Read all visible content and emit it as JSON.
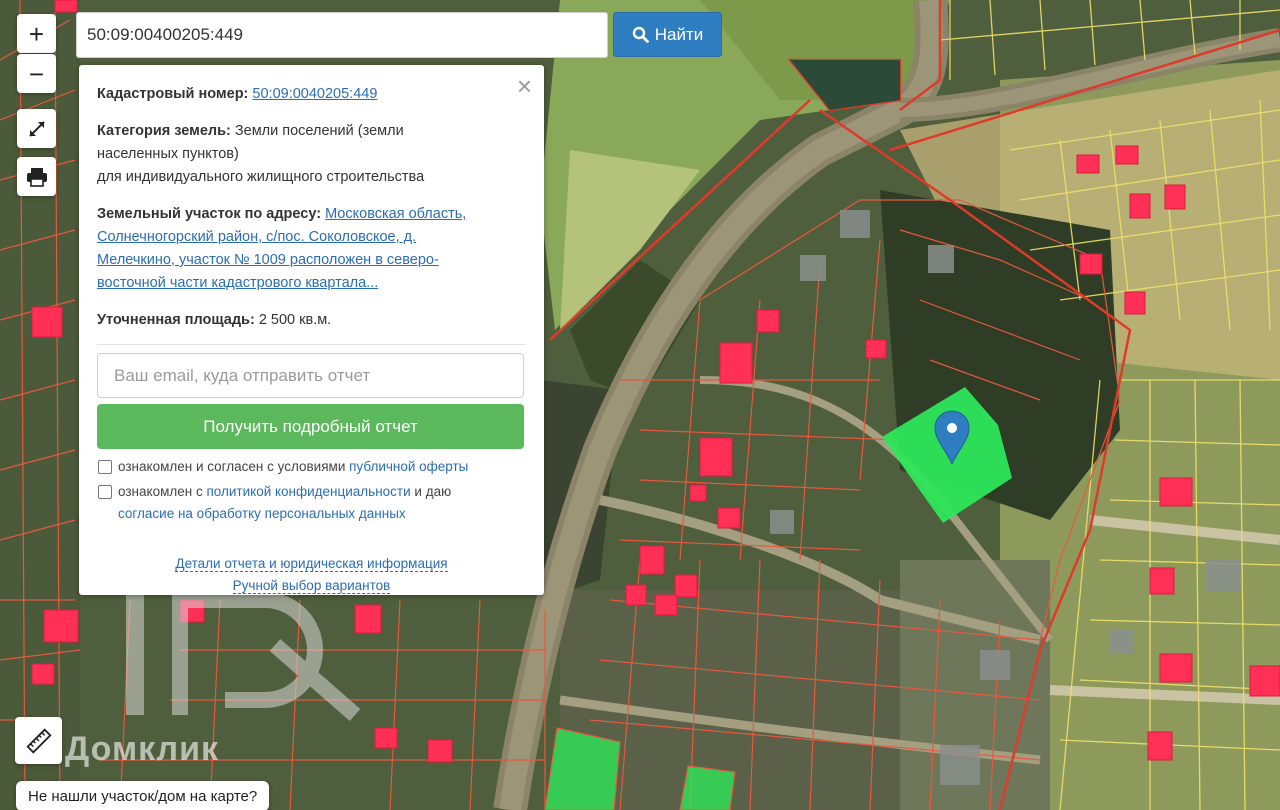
{
  "search": {
    "value": "50:09:00400205:449",
    "button_label": "Найти",
    "button_icon": "search-icon"
  },
  "map_controls": {
    "zoom_in": "+",
    "zoom_out": "−",
    "fullscreen_icon": "fullscreen-icon",
    "print_icon": "print-icon",
    "ruler_icon": "ruler-icon"
  },
  "info": {
    "cadastral_label": "Кадастровый номер:",
    "cadastral_value": "50:09:0040205:449",
    "category_label": "Категория земель:",
    "category_value_1": "Земли поселений (земли",
    "category_value_2": "населенных пунктов)",
    "category_value_3": "для индивидуального жилищного строительства",
    "address_label": "Земельный участок по адресу:",
    "address_1": "Московская область,",
    "address_2": "Солнечногорский район, с/пос. Соколовское, д.",
    "address_3": "Мелечкино, участок № 1009 расположен в северо-",
    "address_4": "восточной части кадастрового квартала...",
    "area_label": "Уточненная площадь:",
    "area_value": "2 500 кв.м.",
    "email_placeholder": "Ваш email, куда отправить отчет",
    "report_button": "Получить подробный отчет",
    "consent1_text": "ознакомлен и согласен с условиями",
    "consent1_link": "публичной оферты",
    "consent2_text": "ознакомлен с",
    "consent2_link": "политикой конфиденциальности",
    "consent2_text2": "и даю",
    "consent2_link2": "согласие на обработку персональных данных",
    "details_link": "Детали отчета и юридическая информация",
    "manual_link": "Ручной выбор вариантов",
    "close_icon": "close-icon"
  },
  "watermark": "Домклик",
  "not_found": "Не нашли участок/дом на карте?",
  "colors": {
    "search_button": "#2f7ec2",
    "report_button": "#5cb85c",
    "link": "#2a6db5",
    "selected_parcel": "#2ee65a",
    "parcel_border": "#e8583c",
    "building": "#ff2f55",
    "pin": "#2f7ec2"
  }
}
